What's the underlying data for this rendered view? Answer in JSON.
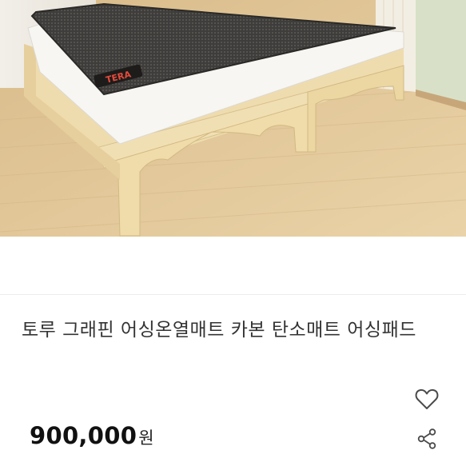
{
  "listing": {
    "image_alt": "Wooden bed frame with carbon heating mattress pad",
    "mat_brand_label": "TERA",
    "title": "토루 그래핀 어싱온열매트 카본 탄소매트 어싱패드",
    "price": "900,000",
    "currency": "원"
  },
  "actions": {
    "favorite_icon": "heart-outline-icon",
    "share_icon": "share-icon"
  },
  "colors": {
    "floor": "#e2c89c",
    "wood_frame": "#efdcae",
    "mat_dark": "#3b3a38",
    "heart_stroke": "#4a4a4a",
    "share_stroke": "#4a4a4a"
  }
}
